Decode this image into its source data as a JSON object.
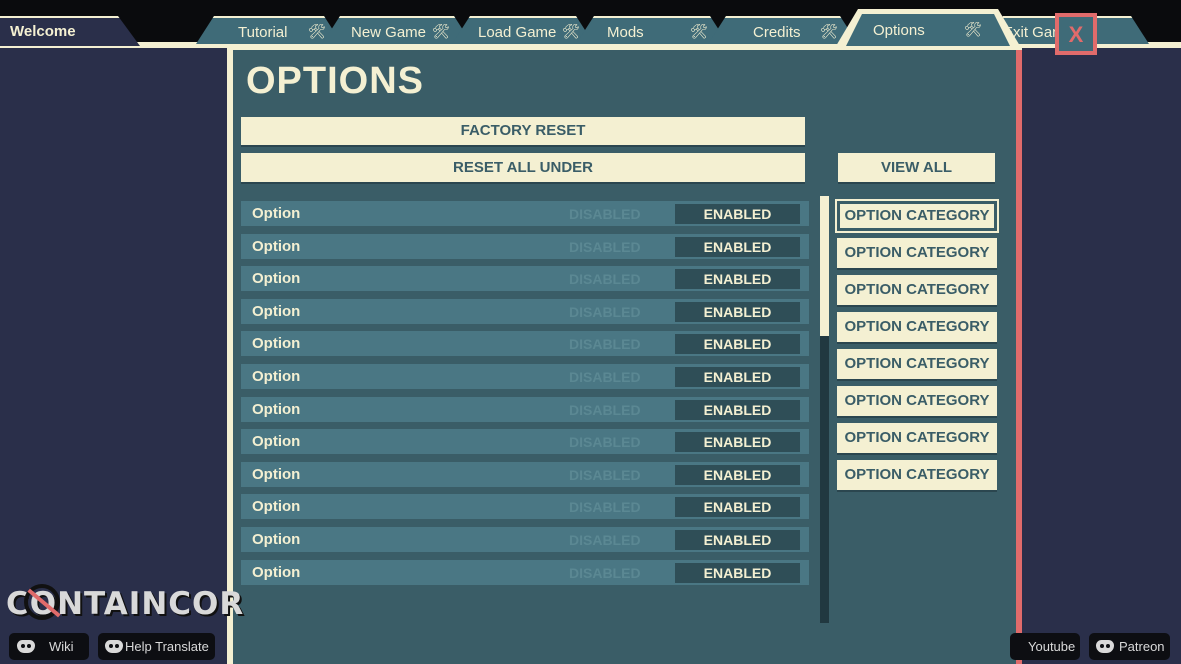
{
  "tabs": {
    "welcome": "Welcome",
    "tutorial": "Tutorial",
    "new_game": "New Game",
    "load_game": "Load Game",
    "mods": "Mods",
    "credits": "Credits",
    "options": "Options",
    "exit_game": "Exit Gam",
    "tool_icon": "🛠"
  },
  "close_label": "X",
  "page_title": "OPTIONS",
  "buttons": {
    "factory_reset": "FACTORY RESET",
    "reset_all_under": "RESET ALL UNDER",
    "view_all": "VIEW ALL"
  },
  "options": [
    {
      "name": "Option",
      "disabled": "DISABLED",
      "enabled": "ENABLED"
    },
    {
      "name": "Option",
      "disabled": "DISABLED",
      "enabled": "ENABLED"
    },
    {
      "name": "Option",
      "disabled": "DISABLED",
      "enabled": "ENABLED"
    },
    {
      "name": "Option",
      "disabled": "DISABLED",
      "enabled": "ENABLED"
    },
    {
      "name": "Option",
      "disabled": "DISABLED",
      "enabled": "ENABLED"
    },
    {
      "name": "Option",
      "disabled": "DISABLED",
      "enabled": "ENABLED"
    },
    {
      "name": "Option",
      "disabled": "DISABLED",
      "enabled": "ENABLED"
    },
    {
      "name": "Option",
      "disabled": "DISABLED",
      "enabled": "ENABLED"
    },
    {
      "name": "Option",
      "disabled": "DISABLED",
      "enabled": "ENABLED"
    },
    {
      "name": "Option",
      "disabled": "DISABLED",
      "enabled": "ENABLED"
    },
    {
      "name": "Option",
      "disabled": "DISABLED",
      "enabled": "ENABLED"
    },
    {
      "name": "Option",
      "disabled": "DISABLED",
      "enabled": "ENABLED"
    }
  ],
  "categories": [
    "OPTION CATEGORY",
    "OPTION CATEGORY",
    "OPTION CATEGORY",
    "OPTION CATEGORY",
    "OPTION CATEGORY",
    "OPTION CATEGORY",
    "OPTION CATEGORY",
    "OPTION CATEGORY"
  ],
  "logo_text": "CONTAINCOR",
  "links": {
    "wiki": "Wiki",
    "help_translate": "Help Translate",
    "youtube": "Youtube",
    "patreon": "Patreon"
  },
  "colors": {
    "accent_cream": "#f4f0d2",
    "panel_teal": "#3a5d67",
    "close_red": "#e06b6b",
    "background_navy": "#2a2f4a"
  }
}
